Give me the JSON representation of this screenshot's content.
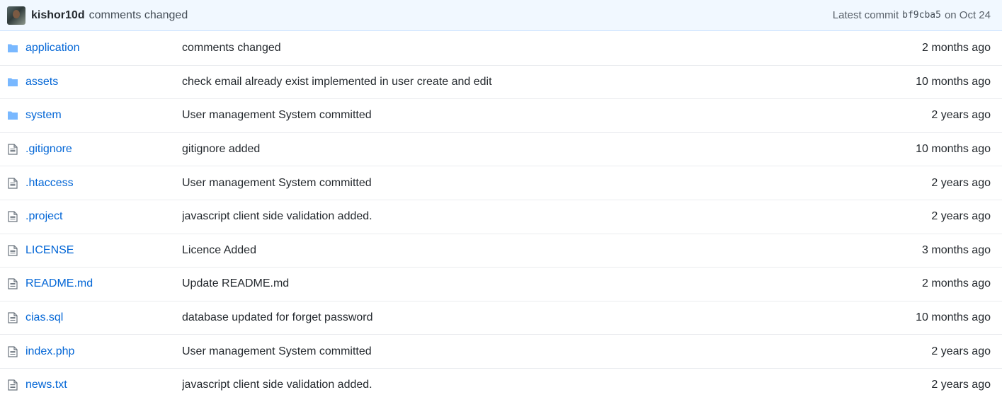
{
  "commit": {
    "author": "kishor10d",
    "message": "comments changed",
    "latest_label": "Latest commit",
    "sha": "bf9cba5",
    "date": "on Oct 24"
  },
  "colors": {
    "link": "#0366d6",
    "folder_icon": "#79b8ff",
    "file_icon": "#6a737d",
    "header_bg": "#f1f8ff"
  },
  "files": [
    {
      "type": "folder",
      "icon": "folder-icon",
      "name": "application",
      "message": "comments changed",
      "age": "2 months ago"
    },
    {
      "type": "folder",
      "icon": "folder-icon",
      "name": "assets",
      "message": "check email already exist implemented in user create and edit",
      "age": "10 months ago"
    },
    {
      "type": "folder",
      "icon": "folder-icon",
      "name": "system",
      "message": "User management System committed",
      "age": "2 years ago"
    },
    {
      "type": "file",
      "icon": "file-icon",
      "name": ".gitignore",
      "message": "gitignore added",
      "age": "10 months ago"
    },
    {
      "type": "file",
      "icon": "file-icon",
      "name": ".htaccess",
      "message": "User management System committed",
      "age": "2 years ago"
    },
    {
      "type": "file",
      "icon": "file-icon",
      "name": ".project",
      "message": "javascript client side validation added.",
      "age": "2 years ago"
    },
    {
      "type": "file",
      "icon": "file-icon",
      "name": "LICENSE",
      "message": "Licence Added",
      "age": "3 months ago"
    },
    {
      "type": "file",
      "icon": "file-icon",
      "name": "README.md",
      "message": "Update README.md",
      "age": "2 months ago"
    },
    {
      "type": "file",
      "icon": "file-icon",
      "name": "cias.sql",
      "message": "database updated for forget password",
      "age": "10 months ago"
    },
    {
      "type": "file",
      "icon": "file-icon",
      "name": "index.php",
      "message": "User management System committed",
      "age": "2 years ago"
    },
    {
      "type": "file",
      "icon": "file-icon",
      "name": "news.txt",
      "message": "javascript client side validation added.",
      "age": "2 years ago"
    }
  ]
}
